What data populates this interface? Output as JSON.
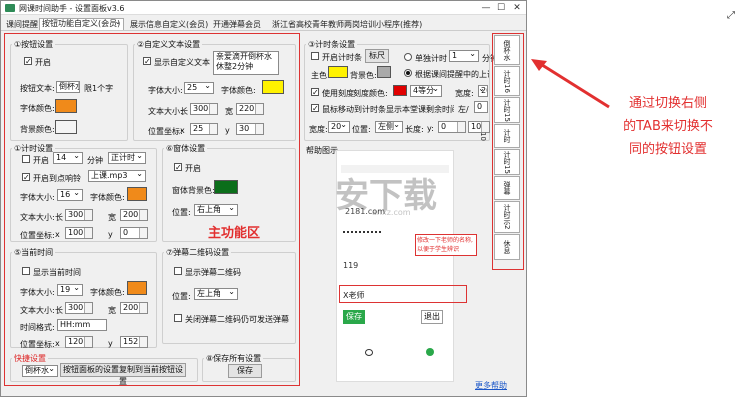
{
  "window": {
    "title": "网课时间助手 - 设置面板v3.6",
    "min": "—",
    "max": "☐",
    "close": "✕"
  },
  "menu": [
    "课间提醒",
    "按钮功能自定义(会员)",
    "展示信息自定义(会员)",
    "开通弹幕会员",
    "浙江省高校青年教师两岗培训小程序(推荐)"
  ],
  "btnset": {
    "title": "①按钮设置",
    "enable": "开启",
    "text_label": "按钮文本:",
    "text_value": "倒杯水",
    "limit": "限1个字",
    "font_color": "字体颜色:",
    "bg_color": "背景颜色:",
    "font_color_hex": "#f08a1a",
    "bg_color_hex": "#f4f4f4"
  },
  "customtext": {
    "title": "②自定义文本设置",
    "show": "显示自定义文本",
    "content": "亲爱滴开倒杯水\n休整2分钟",
    "font_size": "字体大小:",
    "font_size_v": "25",
    "font_color": "字体颜色:",
    "font_color_hex": "#fff200",
    "size": "文本大小:",
    "w": "长",
    "w_v": "300",
    "h": "宽",
    "h_v": "220",
    "pos": "位置坐标:",
    "x": "x",
    "x_v": "25",
    "y": "y",
    "y_v": "30"
  },
  "timerbar": {
    "title": "③计时条设置",
    "enable": "开启计时条",
    "ruler": "标尺",
    "single": "单独计时",
    "single_v": "1",
    "min": "分钟",
    "follow": "根据课间提醒中的上课时间",
    "main": "主色:",
    "main_hex": "#fff200",
    "bg": "背景色:",
    "bg_hex": "#aaaaaa",
    "scale": "使用刻度",
    "scale_color": "刻度颜色:",
    "scale_hex": "#e00000",
    "equal": "4等分",
    "width": "宽度:",
    "width_v": "20",
    "mouse": "鼠标移动到计时条显示本堂课剩余时间",
    "left": "左/",
    "left_v": "0",
    "bottom_w": "宽度:",
    "bw_v": "20",
    "pos": "位置:",
    "pos_v": "左侧",
    "len": "长度:",
    "yl": "y:",
    "yl_v": "0",
    "len_v": "1040"
  },
  "timer": {
    "title": "①计时设置",
    "enable": "开启",
    "enable_v": "14",
    "unit": "分钟",
    "mode": "正计时",
    "bell": "开启到点响铃",
    "bell_v": "上课.mp3",
    "font_size": "字体大小:",
    "font_size_v": "16",
    "font_color": "字体颜色:",
    "font_color_hex": "#f08a1a",
    "size": "文本大小:",
    "w": "长",
    "w_v": "300",
    "h": "宽",
    "h_v": "200",
    "pos": "位置坐标:",
    "x": "x",
    "x_v": "100",
    "y": "y",
    "y_v": "0"
  },
  "window_set": {
    "title": "⑥窗体设置",
    "enable": "开启",
    "bg": "窗体背景色:",
    "bg_hex": "#0b6e1a",
    "pos": "位置:",
    "pos_v": "右上角"
  },
  "curtime": {
    "title": "⑤当前时间",
    "show": "显示当前时间",
    "font_size": "字体大小:",
    "font_size_v": "19",
    "font_color": "字体颜色:",
    "font_color_hex": "#f08a1a",
    "size": "文本大小:",
    "w": "长",
    "w_v": "300",
    "h": "宽",
    "h_v": "200",
    "fmt": "时间格式:",
    "fmt_v": "HH:mm",
    "pos": "位置坐标:",
    "x": "x",
    "x_v": "120",
    "y": "y",
    "y_v": "152"
  },
  "danmu_qr": {
    "title": "⑦弹幕二维码设置",
    "show": "显示弹幕二维码",
    "pos": "位置:",
    "pos_v": "左上角",
    "close": "关闭弹幕二维码仍可发送弹幕"
  },
  "quick": {
    "title": "快捷设置",
    "sel": "倒杯水",
    "copy": "按钮面板的设置复制到当前按钮设置"
  },
  "save": {
    "title": "⑧保存所有设置",
    "btn": "保存"
  },
  "help": {
    "title": "帮助图示",
    "phone_site": "2181.com",
    "phone_code": "119",
    "phone_name": "X老师",
    "phone_note": "修改一下老师的名称,\n以便于学生辨识",
    "phone_save": "保存",
    "phone_exit": "退出",
    "link": "更多帮助"
  },
  "vtabs": [
    "倒杯水",
    "计时16",
    "计时15",
    "计时10",
    "计时15",
    "弹幕",
    "计时示2",
    "休息"
  ],
  "watermark": "安下载",
  "watermark_sub": "anxz.com",
  "annot_main": "主功能区",
  "annot_right": "通过切换右侧\n的TAB来切换不\n同的按钮设置"
}
